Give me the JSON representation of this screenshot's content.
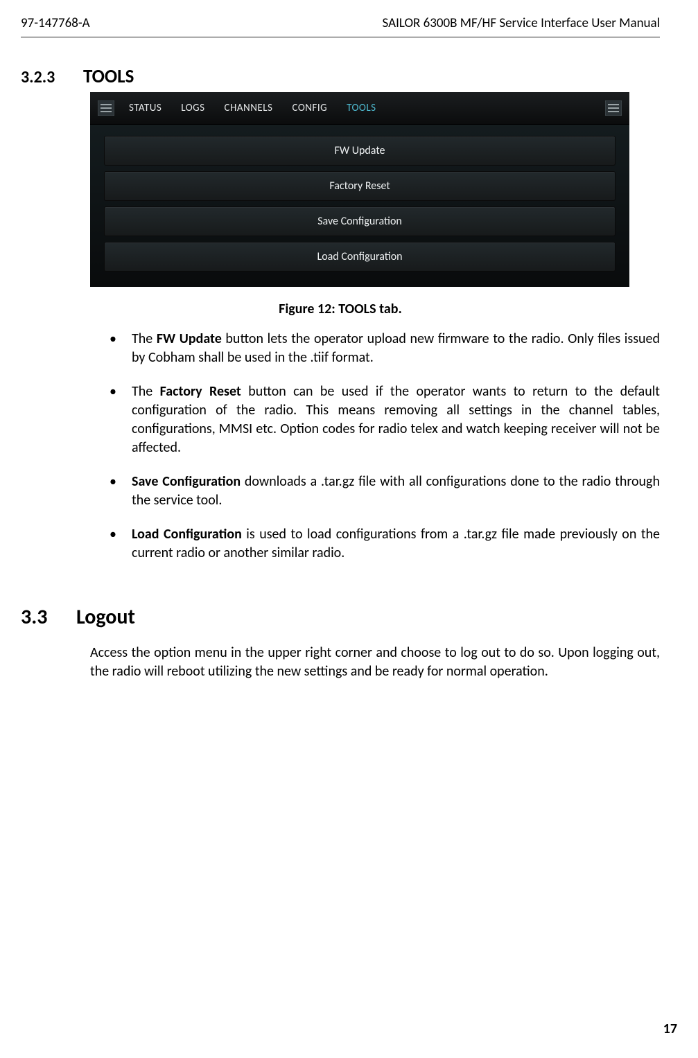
{
  "header": {
    "doc_code": "97-147768-A",
    "doc_title": "SAILOR 6300B MF/HF Service Interface User Manual"
  },
  "sec_323": {
    "num": "3.2.3",
    "title": "TOOLS"
  },
  "screenshot": {
    "tabs": {
      "status": "STATUS",
      "logs": "LOGS",
      "channels": "CHANNELS",
      "config": "CONFIG",
      "tools": "TOOLS"
    },
    "items": {
      "fw_update": "FW Update",
      "factory_reset": "Factory Reset",
      "save_config": "Save Configuration",
      "load_config": "Load Configuration"
    }
  },
  "fig_caption": "Figure 12: TOOLS tab.",
  "bullets": {
    "b1_pre": "The ",
    "b1_bold": "FW Update",
    "b1_post": " button lets the operator upload new firmware to the radio. Only files issued by Cobham shall be used in the .tiif format.",
    "b2_pre": "The ",
    "b2_bold": "Factory Reset",
    "b2_post": " button can be used if the operator wants to return to the default configuration of the radio. This means removing all settings in the channel tables, configurations, MMSI etc. Option codes for radio telex and watch keeping receiver will not be affected.",
    "b3_bold": "Save Configuration",
    "b3_post": " downloads a .tar.gz file with all configurations done to the radio through the service tool.",
    "b4_bold": "Load Configuration",
    "b4_post": " is used to load configurations from a .tar.gz file made previously on the current radio or another similar radio."
  },
  "sec_33": {
    "num": "3.3",
    "title": "Logout"
  },
  "logout_para": "Access the option menu in the upper right corner and choose to log out to do so. Upon logging out, the radio will reboot utilizing the new settings and be ready for normal operation.",
  "page_number": "17"
}
